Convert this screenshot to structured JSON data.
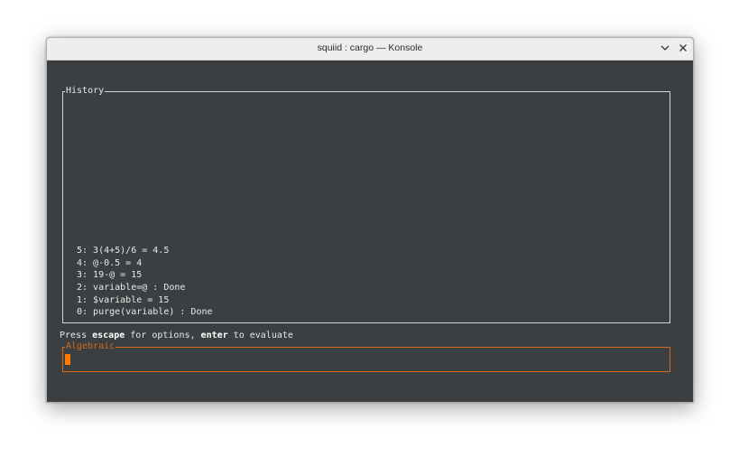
{
  "window": {
    "title": "squiid : cargo — Konsole"
  },
  "titlebar_buttons": [
    {
      "icon": "chevron-down-icon"
    },
    {
      "icon": "close-icon"
    }
  ],
  "history": {
    "title": "History",
    "entries": [
      "5: 3(4+5)/6 = 4.5",
      "4: @-0.5 = 4",
      "3: 19-@ = 15",
      "2: variable=@ : Done",
      "1: $variable = 15",
      "0: purge(variable) : Done"
    ]
  },
  "hint": {
    "prefix": "Press ",
    "key1": "escape",
    "middle": " for options, ",
    "key2": "enter",
    "suffix": " to evaluate"
  },
  "input": {
    "title": "Algebraic",
    "value": ""
  },
  "colors": {
    "terminal_bg": "#3c3f41",
    "text": "#e8e8e8",
    "accent": "#d2691e",
    "cursor": "#ff7a00"
  }
}
